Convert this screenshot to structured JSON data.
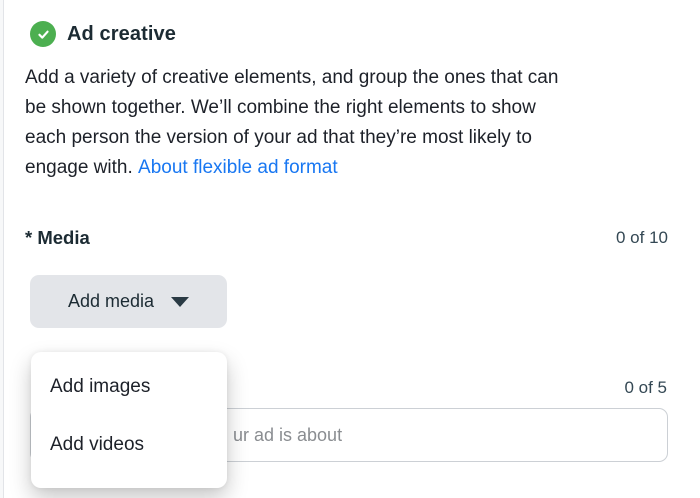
{
  "colors": {
    "accent_green": "#4caf50",
    "link_blue": "#1877f2",
    "button_gray": "#e3e5e9",
    "text_dark": "#1c2b33"
  },
  "section": {
    "title": "Ad creative",
    "status_icon": "check-circle-icon",
    "description": {
      "lines": [
        "Add a variety of creative elements, and group the ones that can",
        "be shown together. We’ll combine the right elements to show",
        "each person the version of your ad that they’re most likely to",
        "engage with."
      ],
      "link_label": "About flexible ad format"
    },
    "media_field": {
      "label": "* Media",
      "counter": "0 of 10",
      "button_label": "Add media",
      "button_icon": "caret-down-icon",
      "menu_items": [
        {
          "label": "Add images"
        },
        {
          "label": "Add videos"
        }
      ]
    },
    "text_field": {
      "counter": "0 of 5",
      "placeholder_visible": "ur ad is about"
    }
  }
}
